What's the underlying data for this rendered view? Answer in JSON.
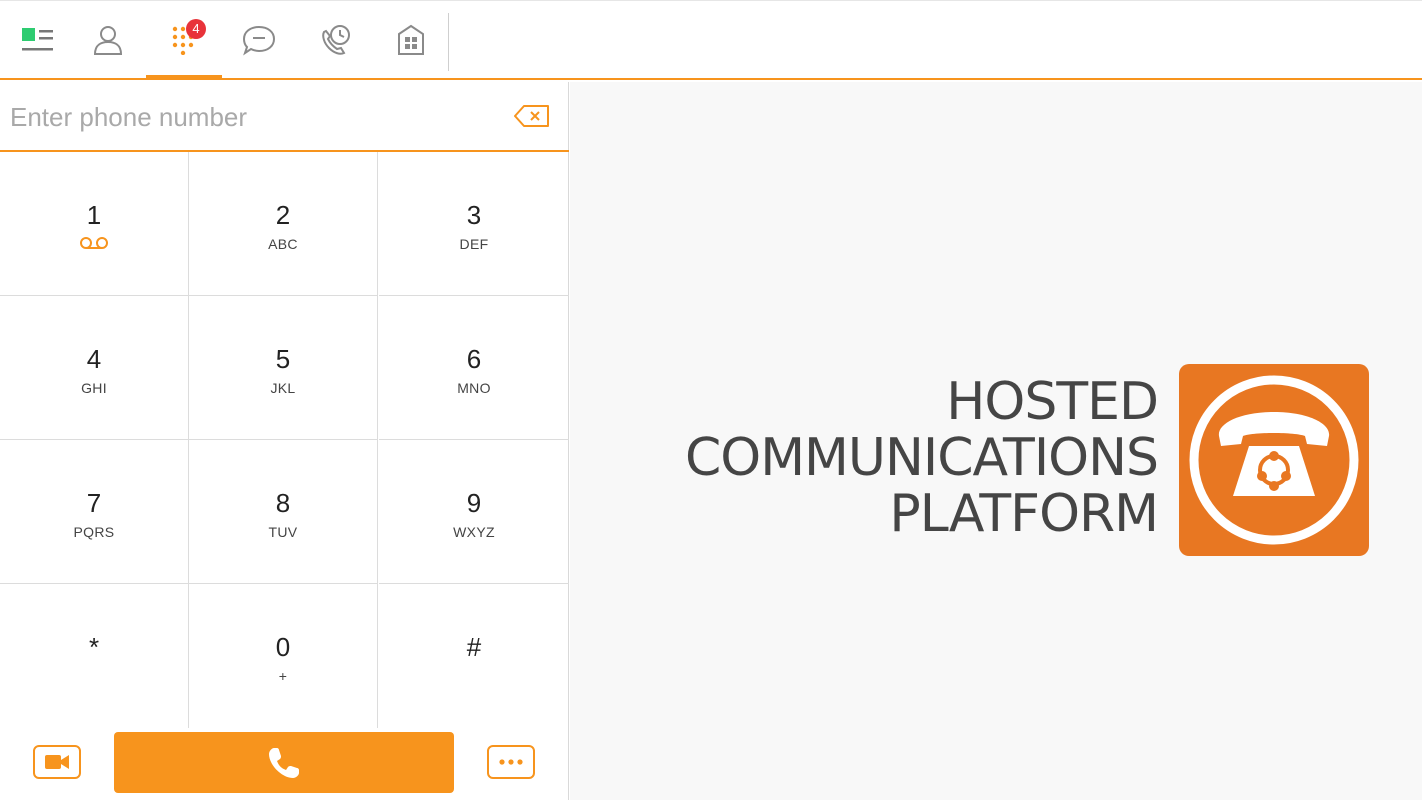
{
  "nav": {
    "tabs": [
      {
        "name": "menu",
        "icon": "menu-icon"
      },
      {
        "name": "contacts",
        "icon": "person-icon"
      },
      {
        "name": "dialpad",
        "icon": "dialpad-icon",
        "active": true,
        "badge": "4"
      },
      {
        "name": "messages",
        "icon": "chat-bubble-icon"
      },
      {
        "name": "call-history",
        "icon": "call-history-icon"
      },
      {
        "name": "directory",
        "icon": "building-icon"
      }
    ],
    "badge_color": "#e8333a",
    "accent_color": "#f7941d"
  },
  "dialer": {
    "placeholder": "Enter phone number",
    "value": "",
    "keys": [
      {
        "digit": "1",
        "letters": "",
        "voicemail": true
      },
      {
        "digit": "2",
        "letters": "ABC"
      },
      {
        "digit": "3",
        "letters": "DEF"
      },
      {
        "digit": "4",
        "letters": "GHI"
      },
      {
        "digit": "5",
        "letters": "JKL"
      },
      {
        "digit": "6",
        "letters": "MNO"
      },
      {
        "digit": "7",
        "letters": "PQRS"
      },
      {
        "digit": "8",
        "letters": "TUV"
      },
      {
        "digit": "9",
        "letters": "WXYZ"
      },
      {
        "digit": "*",
        "letters": ""
      },
      {
        "digit": "0",
        "letters": "+"
      },
      {
        "digit": "#",
        "letters": ""
      }
    ],
    "more_label": "•••"
  },
  "brand": {
    "line1": "HOSTED",
    "line2": "COMMUNICATIONS",
    "line3": "PLATFORM",
    "logo_color": "#e87722"
  }
}
